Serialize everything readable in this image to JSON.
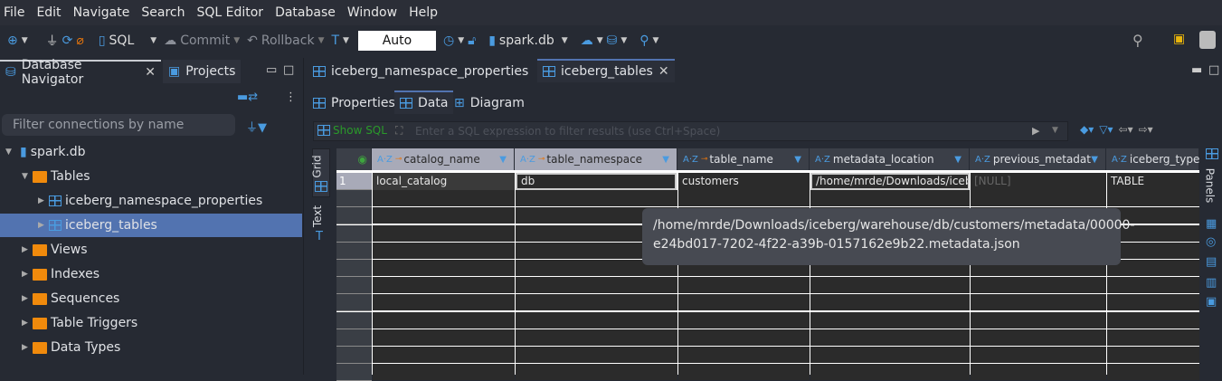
{
  "menu": [
    "File",
    "Edit",
    "Navigate",
    "Search",
    "SQL Editor",
    "Database",
    "Window",
    "Help"
  ],
  "toolbar": {
    "sql": "SQL",
    "commit": "Commit",
    "rollback": "Rollback",
    "mode": "Auto",
    "datasource": "spark.db"
  },
  "left_tabs": {
    "navigator": "Database Navigator",
    "projects": "Projects"
  },
  "filter_placeholder": "Filter connections by name",
  "tree": [
    {
      "label": "spark.db",
      "level": 0,
      "expanded": true,
      "icon": "database-icon"
    },
    {
      "label": "Tables",
      "level": 1,
      "expanded": true,
      "icon": "folder-tables-icon"
    },
    {
      "label": "iceberg_namespace_properties",
      "level": 2,
      "icon": "table-icon"
    },
    {
      "label": "iceberg_tables",
      "level": 2,
      "icon": "table-icon",
      "selected": true
    },
    {
      "label": "Views",
      "level": 1,
      "icon": "views-icon"
    },
    {
      "label": "Indexes",
      "level": 1,
      "icon": "folder-icon"
    },
    {
      "label": "Sequences",
      "level": 1,
      "icon": "folder-icon"
    },
    {
      "label": "Table Triggers",
      "level": 1,
      "icon": "folder-icon"
    },
    {
      "label": "Data Types",
      "level": 1,
      "icon": "folder-icon"
    }
  ],
  "editor_tabs": [
    "iceberg_namespace_properties",
    "iceberg_tables"
  ],
  "sub_tabs": [
    "Properties",
    "Data",
    "Diagram"
  ],
  "show_sql": "Show SQL",
  "filter_sql_placeholder": "Enter a SQL expression to filter results (use Ctrl+Space)",
  "side_tabs": [
    "Grid",
    "Text"
  ],
  "panels_label": "Panels",
  "columns": [
    "catalog_name",
    "table_namespace",
    "table_name",
    "metadata_location",
    "previous_metadat",
    "iceberg_type"
  ],
  "rows": [
    [
      "1",
      "local_catalog",
      "db",
      "customers",
      "/home/mrde/Downloads/icebe",
      "[NULL]",
      "TABLE"
    ]
  ],
  "tooltip": "/home/mrde/Downloads/iceberg/warehouse/db/customers/metadata/00000-e24bd017-7202-4f22-a39b-0157162e9b22.metadata.json"
}
